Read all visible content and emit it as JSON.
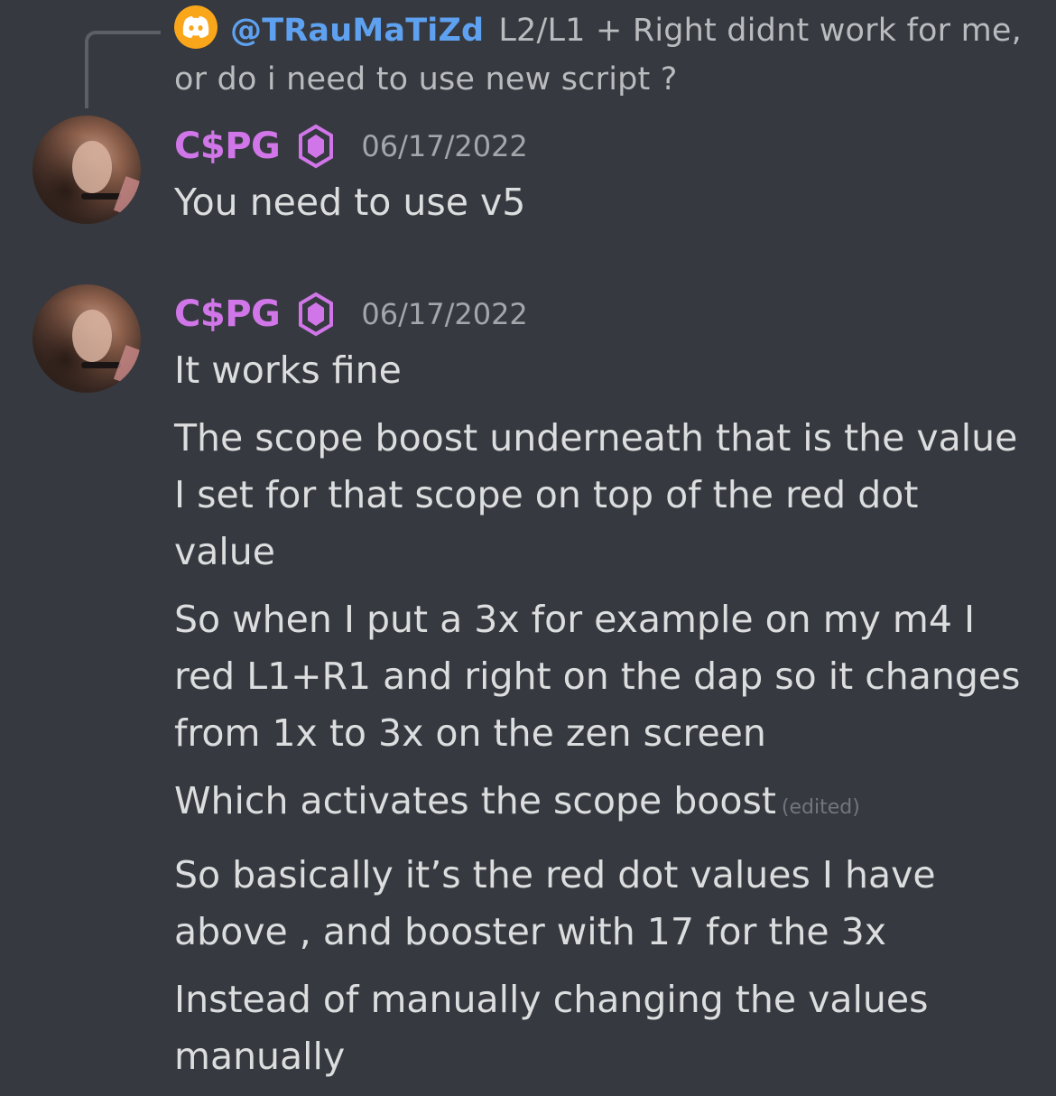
{
  "reply": {
    "icon": "discord-logo-icon",
    "user": "@TRauMaTiZd",
    "text": "L2/L1 +  Right didnt work for me, or do i need to use new script ?"
  },
  "messages": [
    {
      "username": "C$PG",
      "badge_icon": "hexagon-badge-icon",
      "timestamp": "06/17/2022",
      "lines": [
        "You need to use v5"
      ]
    },
    {
      "username": "C$PG",
      "badge_icon": "hexagon-badge-icon",
      "timestamp": "06/17/2022",
      "lines": [
        "It works fine",
        "The scope boost underneath that is the value I set for that scope on top of the red dot value",
        "So when I put a 3x for example on my m4 I red L1+R1 and right on the dap so it changes from 1x to 3x on the zen screen",
        "Which activates the scope boost",
        "So basically it’s the red dot values I have above , and booster with 17 for the 3x",
        "Instead of manually changing the values manually"
      ],
      "edited_label": "(edited)"
    }
  ],
  "colors": {
    "background": "#36393f",
    "username": "#d176e8",
    "text": "#dcddde",
    "muted": "#a3a6aa",
    "reply_user": "#5ea1f0"
  }
}
